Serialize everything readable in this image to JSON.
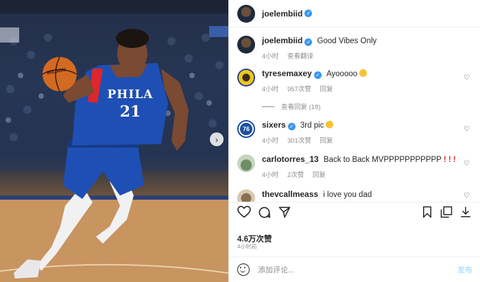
{
  "post": {
    "author": "joelembiid",
    "caption": "Good Vibes Only",
    "caption_time": "4小时",
    "translate": "查看翻译",
    "jersey_team": "PHILA",
    "jersey_number": "21",
    "ball_brand": "WILSON"
  },
  "comments": [
    {
      "user": "tyresemaxey",
      "text": "Ayooooo",
      "time": "4小时",
      "likes": "957次赞",
      "reply": "回复",
      "verified": true
    },
    {
      "user": "sixers",
      "text": "3rd pic",
      "time": "4小时",
      "likes": "301次赞",
      "reply": "回复",
      "verified": true
    },
    {
      "user": "carlotorres_13",
      "text": "Back to Back MVPPPPPPPPPPP",
      "bangs": "! ! !",
      "time": "4小时",
      "likes": "2次赞",
      "reply": "回复",
      "verified": false
    },
    {
      "user": "thevcallmeass",
      "text": "i love you dad",
      "verified": false
    }
  ],
  "view_replies": "查看回复 (18)",
  "stats": {
    "likes": "4.6万次赞",
    "time": "4小时前"
  },
  "add_comment": {
    "placeholder": "添加评论...",
    "post": "发布"
  },
  "icons": [
    "heart-icon",
    "comment-icon",
    "share-icon",
    "bookmark-icon",
    "save-icon",
    "download-icon",
    "emoji-icon"
  ]
}
